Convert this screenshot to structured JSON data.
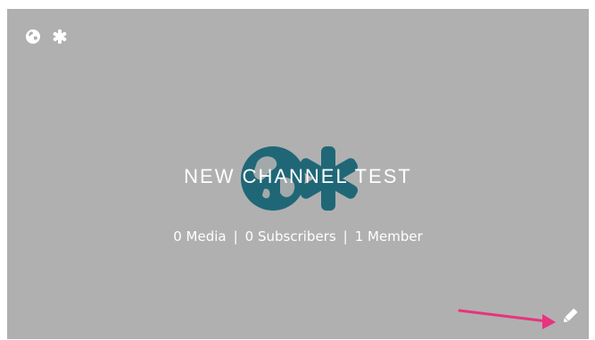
{
  "channel": {
    "title": "NEW CHANNEL TEST",
    "stats": {
      "media": "0 Media",
      "subscribers": "0 Subscribers",
      "members": "1 Member"
    },
    "separator": "|"
  },
  "icons": {
    "top": [
      "globe-icon",
      "asterisk-icon"
    ],
    "center": [
      "globe-icon",
      "asterisk-icon"
    ],
    "edit": "pencil-icon",
    "arrow": "arrow-annotation"
  },
  "colors": {
    "card_background": "#b0b0b0",
    "icon_teal": "#1f6777",
    "arrow_pink": "#e8337d",
    "text": "#ffffff"
  }
}
